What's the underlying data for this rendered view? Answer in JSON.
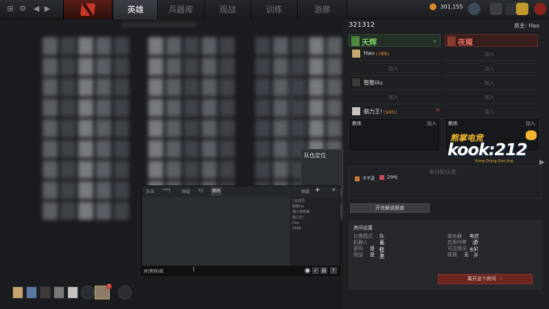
{
  "nav": {
    "tabs": [
      "英雄",
      "兵器库",
      "观战",
      "训练",
      "游廊"
    ],
    "active_tab": "英雄"
  },
  "currency": {
    "amount": "301,155"
  },
  "chat": {
    "tabs": [
      "队伍",
      "***|",
      "频道",
      "Xy",
      "房间"
    ],
    "right_tab": "频道",
    "members": [
      "1名成员",
      "憨憨iiiu",
      "爆小帅吻嘴",
      "脑力王!",
      "Hao",
      "ZSMJ"
    ],
    "input_label": "对(房间)说:"
  },
  "team_position": {
    "title": "队伍定位"
  },
  "party": {
    "lead_badge": "1"
  },
  "lobby": {
    "id": "321312",
    "host_label": "房主:",
    "host_name": "Hao",
    "radiant": {
      "name": "天辉",
      "color": "#7ed36a",
      "players": [
        {
          "name": "Hao",
          "tag": "[小憨憨]"
        },
        {
          "name": "",
          "tag": ""
        },
        {
          "name": "憨憨iiiu",
          "tag": ""
        },
        {
          "name": "",
          "tag": ""
        },
        {
          "name": "脑力王!",
          "tag": "[没有队]"
        }
      ]
    },
    "dire": {
      "name": "夜魇",
      "color": "#e06a5a"
    },
    "join_label": "加入",
    "coach_label": "教练",
    "unassigned": {
      "title": "未分配玩家",
      "players": [
        "子不语",
        "ZSMJ"
      ]
    },
    "caster_button": "开关解说频道",
    "settings": {
      "title": "房间设置",
      "left": [
        {
          "k": "比赛模式",
          "v": "队长模式"
        },
        {
          "k": "机器人",
          "v": "无 / 无"
        },
        {
          "k": "密码",
          "v": "是"
        },
        {
          "k": "观战",
          "v": "是"
        }
      ],
      "right": [
        {
          "k": "服务器",
          "v": "电信（广东）"
        },
        {
          "k": "启用作弊",
          "v": "否"
        },
        {
          "k": "可见情况",
          "v": "公开"
        },
        {
          "k": "联赛",
          "v": "无"
        }
      ]
    },
    "leave_button": "离开这个房间"
  },
  "watermark": {
    "line1": "熊掌电竞",
    "line2": "kook:212",
    "line3": "Xiong Zhang Dian Jing"
  }
}
